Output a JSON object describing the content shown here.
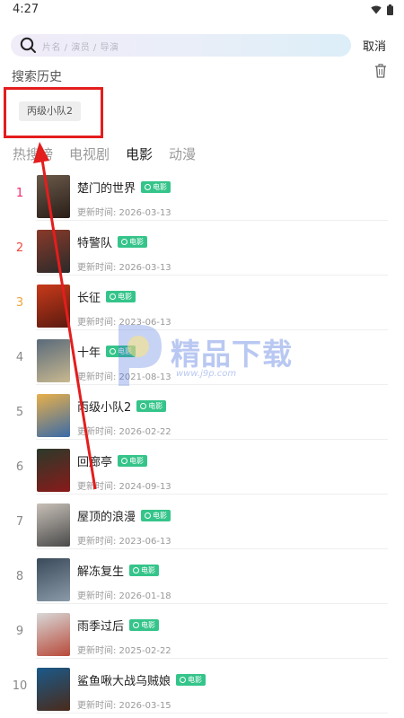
{
  "status": {
    "time": "4:27"
  },
  "search": {
    "placeholder": "片名 / 演员 / 导演",
    "cancel_label": "取消"
  },
  "history": {
    "title": "搜索历史",
    "items": [
      "丙级小队2"
    ]
  },
  "tabs": [
    {
      "label": "热搜榜",
      "active": false
    },
    {
      "label": "电视剧",
      "active": false
    },
    {
      "label": "电影",
      "active": true
    },
    {
      "label": "动漫",
      "active": false
    }
  ],
  "colors": {
    "rank1": "#f3286e",
    "rank2": "#ef4a3c",
    "rank3": "#f1a33a",
    "rank_other": "#888888",
    "badge": "#35c48a",
    "highlight": "#e41d1d"
  },
  "list": [
    {
      "rank": "1",
      "title": "楚门的世界",
      "badge": "电影",
      "date": "更新时间: 2026-03-13"
    },
    {
      "rank": "2",
      "title": "特警队",
      "badge": "电影",
      "date": "更新时间: 2026-03-13"
    },
    {
      "rank": "3",
      "title": "长征",
      "badge": "电影",
      "date": "更新时间: 2023-06-13"
    },
    {
      "rank": "4",
      "title": "十年",
      "badge": "电影",
      "date": "更新时间: 2021-08-13"
    },
    {
      "rank": "5",
      "title": "丙级小队2",
      "badge": "电影",
      "date": "更新时间: 2026-02-22"
    },
    {
      "rank": "6",
      "title": "回廊亭",
      "badge": "电影",
      "date": "更新时间: 2024-09-13"
    },
    {
      "rank": "7",
      "title": "屋顶的浪漫",
      "badge": "电影",
      "date": "更新时间: 2023-06-13"
    },
    {
      "rank": "8",
      "title": "解冻复生",
      "badge": "电影",
      "date": "更新时间: 2026-01-18"
    },
    {
      "rank": "9",
      "title": "雨季过后",
      "badge": "电影",
      "date": "更新时间: 2025-02-22"
    },
    {
      "rank": "10",
      "title": "鲨鱼啾大战乌贼娘",
      "badge": "电影",
      "date": "更新时间: 2026-03-15"
    }
  ],
  "watermark": {
    "text": "精品下载",
    "url": "www.j9p.com"
  }
}
